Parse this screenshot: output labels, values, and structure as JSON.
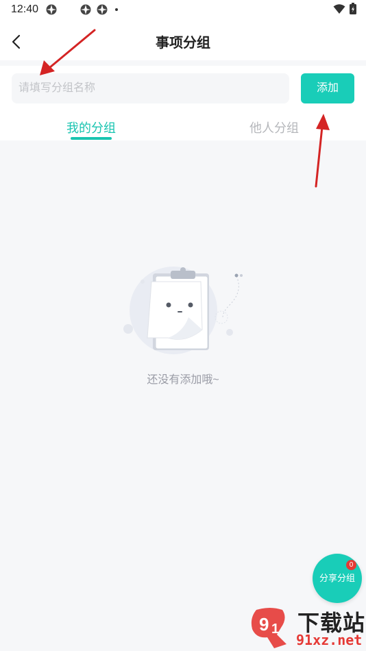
{
  "status": {
    "time": "12:40"
  },
  "header": {
    "title": "事项分组"
  },
  "search": {
    "placeholder": "请填写分组名称",
    "value": ""
  },
  "add_button": {
    "label": "添加"
  },
  "tabs": [
    {
      "label": "我的分组",
      "active": true
    },
    {
      "label": "他人分组",
      "active": false
    }
  ],
  "empty": {
    "text": "还没有添加哦~"
  },
  "share": {
    "label": "分享分组",
    "badge": "0"
  },
  "watermark": {
    "brand": "下载站",
    "site": "91xz.net"
  },
  "colors": {
    "accent": "#19cdb8",
    "arrow": "#d42424",
    "badge": "#e53935"
  },
  "icons": {
    "back": "chevron-left-icon",
    "wifi": "wifi-icon",
    "battery": "battery-icon"
  }
}
